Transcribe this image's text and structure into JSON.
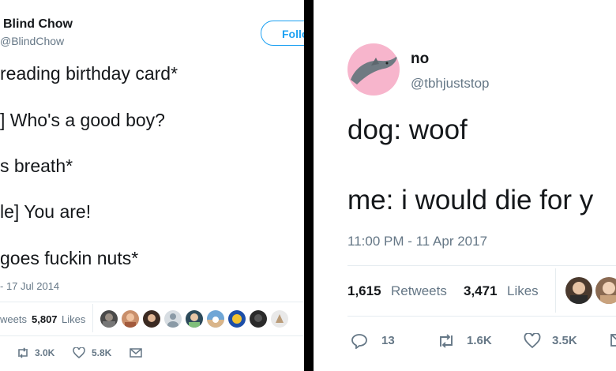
{
  "left_tweet": {
    "display_name": "Blind Chow",
    "handle": "@BlindChow",
    "follow_label": "Follo",
    "lines": [
      "reading birthday card*",
      "] Who's a good boy?",
      "s breath*",
      "le] You are!",
      "goes fuckin nuts*"
    ],
    "timestamp": "- 17 Jul 2014",
    "retweets_label": "weets",
    "likes_count": "5,807",
    "likes_label": "Likes",
    "actions": {
      "retweet_count": "3.0K",
      "like_count": "5.8K"
    }
  },
  "right_tweet": {
    "display_name": "no",
    "handle": "@tbhjuststop",
    "lines": [
      "dog: woof",
      "me: i would die for y"
    ],
    "timestamp": "11:00 PM - 11 Apr 2017",
    "retweets_count": "1,615",
    "retweets_label": "Retweets",
    "likes_count": "3,471",
    "likes_label": "Likes",
    "actions": {
      "reply_count": "13",
      "retweet_count": "1.6K",
      "like_count": "3.5K"
    }
  },
  "colors": {
    "brand": "#1da1f2",
    "muted": "#657786",
    "avatar_bg": "#f7b5cc"
  },
  "icons": [
    "retweet-icon",
    "heart-icon",
    "mail-icon",
    "reply-icon",
    "dolphin-icon"
  ]
}
